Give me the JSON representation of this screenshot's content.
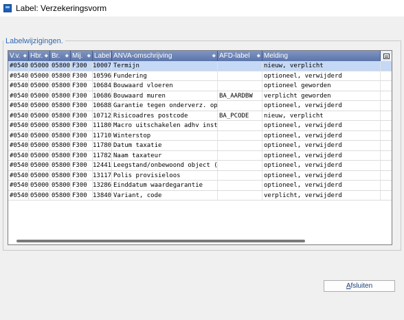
{
  "window": {
    "title": "Label: Verzekeringsvorm",
    "icon": "app-icon"
  },
  "group": {
    "label": "Labelwijzigingen."
  },
  "table": {
    "columns": [
      "V.v.",
      "Hbr.",
      "Br.",
      "Mij.",
      "Label",
      "ANVA-omschrijving",
      "AFD-label",
      "Melding"
    ],
    "corner_icon": "column-chooser-icon",
    "selected_row": 0,
    "rows": [
      [
        "#0540",
        "05000",
        "05800",
        "F300",
        "10007",
        "Termijn",
        "",
        "nieuw, verplicht"
      ],
      [
        "#0540",
        "05000",
        "05800",
        "F300",
        "10596",
        "Fundering",
        "",
        "optioneel, verwijderd"
      ],
      [
        "#0540",
        "05000",
        "05800",
        "F300",
        "10684",
        "Bouwaard vloeren",
        "",
        "optioneel geworden"
      ],
      [
        "#0540",
        "05000",
        "05800",
        "F300",
        "10686",
        "Bouwaard muren",
        "BA_AARDBW",
        "verplicht geworden"
      ],
      [
        "#0540",
        "05000",
        "05800",
        "F300",
        "10688",
        "Garantie tegen onderverz. opst",
        "",
        "optioneel, verwijderd"
      ],
      [
        "#0540",
        "05000",
        "05800",
        "F300",
        "10712",
        "Risicoadres postcode",
        "BA_PCODE",
        "nieuw, verplicht"
      ],
      [
        "#0540",
        "05000",
        "05800",
        "F300",
        "11180",
        "Macro uitschakelen adhv inst.",
        "",
        "optioneel, verwijderd"
      ],
      [
        "#0540",
        "05000",
        "05800",
        "F300",
        "11710",
        "Winterstop",
        "",
        "optioneel, verwijderd"
      ],
      [
        "#0540",
        "05000",
        "05800",
        "F300",
        "11780",
        "Datum taxatie",
        "",
        "optioneel, verwijderd"
      ],
      [
        "#0540",
        "05000",
        "05800",
        "F300",
        "11782",
        "Naam taxateur",
        "",
        "optioneel, verwijderd"
      ],
      [
        "#0540",
        "05000",
        "05800",
        "F300",
        "12441",
        "Leegstand/onbewoond object (J/",
        "",
        "optioneel, verwijderd"
      ],
      [
        "#0540",
        "05000",
        "05800",
        "F300",
        "13117",
        "Polis provisieloos",
        "",
        "optioneel, verwijderd"
      ],
      [
        "#0540",
        "05000",
        "05800",
        "F300",
        "13286",
        "Einddatum waardegarantie",
        "",
        "optioneel, verwijderd"
      ],
      [
        "#0540",
        "05000",
        "05800",
        "F300",
        "13840",
        "Variant, code",
        "",
        "verplicht, verwijderd"
      ]
    ]
  },
  "buttons": {
    "close_accel": "A",
    "close_rest": "fsluiten"
  },
  "colors": {
    "header_bg": "#6a82b6",
    "selected_row": "#c5d8f5",
    "group_label": "#2e67b1"
  }
}
